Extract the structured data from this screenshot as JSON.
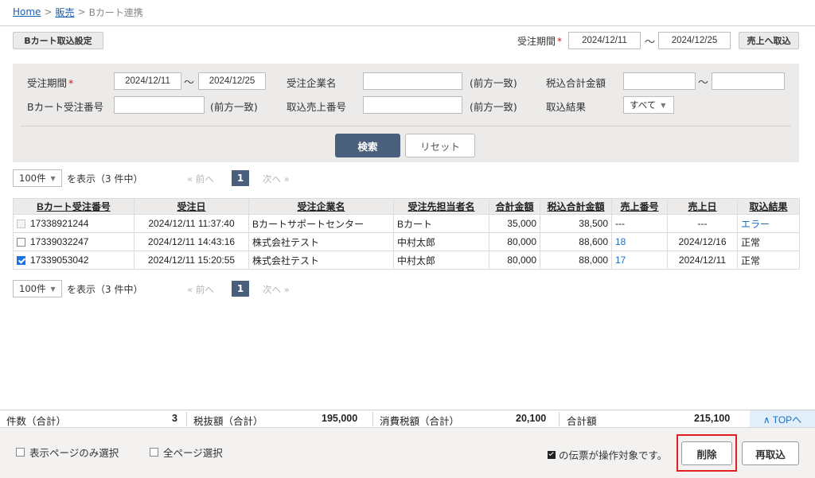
{
  "breadcrumb": {
    "home": "Home",
    "sep1": ">",
    "sales": "販売",
    "sep2": ">",
    "current": "Bカート連携"
  },
  "toolbar": {
    "settings_button": "Bカート取込設定",
    "period_label": "受注期間",
    "required_mark": "*",
    "date_from": "2024/12/11",
    "tilde": "～",
    "date_to": "2024/12/25",
    "import_button": "売上へ取込"
  },
  "search": {
    "period_label": "受注期間",
    "required_mark": "*",
    "date_from": "2024/12/11",
    "tilde": "～",
    "date_to": "2024/12/25",
    "company_label": "受注企業名",
    "company_value": "",
    "company_hint": "(前方一致)",
    "tax_total_label": "税込合計金額",
    "tax_total_from": "",
    "tax_total_tilde": "～",
    "tax_total_to": "",
    "order_no_label": "Bカート受注番号",
    "order_no_value": "",
    "order_no_hint": "(前方一致)",
    "sales_no_label": "取込売上番号",
    "sales_no_value": "",
    "sales_no_hint": "(前方一致)",
    "result_label": "取込結果",
    "result_value": "すべて",
    "search_button": "検索",
    "reset_button": "リセット"
  },
  "pager": {
    "per_page": "100件",
    "show_label": "を表示（3 件中）",
    "prev": "« 前へ",
    "current_page": "1",
    "next": "次へ »"
  },
  "table": {
    "headers": [
      "Bカート受注番号",
      "受注日",
      "受注企業名",
      "受注先担当者名",
      "合計金額",
      "税込合計金額",
      "売上番号",
      "売上日",
      "取込結果"
    ],
    "rows": [
      {
        "checkbox": "disabled",
        "order_no": "17338921244",
        "date": "2024/12/11 11:37:40",
        "company": "Bカートサポートセンター",
        "contact": "Bカート",
        "total": "35,000",
        "tax_total": "38,500",
        "sales_no": "---",
        "sales_date": "---",
        "result": "エラー"
      },
      {
        "checkbox": "unchecked",
        "order_no": "17339032247",
        "date": "2024/12/11 14:43:16",
        "company": "株式会社テスト",
        "contact": "中村太郎",
        "total": "80,000",
        "tax_total": "88,600",
        "sales_no": "18",
        "sales_date": "2024/12/16",
        "result": "正常"
      },
      {
        "checkbox": "checked",
        "order_no": "17339053042",
        "date": "2024/12/11 15:20:55",
        "company": "株式会社テスト",
        "contact": "中村太郎",
        "total": "80,000",
        "tax_total": "88,000",
        "sales_no": "17",
        "sales_date": "2024/12/11",
        "result": "正常"
      }
    ]
  },
  "totals": {
    "count_label": "件数（合計）",
    "count": "3",
    "pretax_label": "税抜額（合計）",
    "pretax": "195,000",
    "tax_label": "消費税額（合計）",
    "tax": "20,100",
    "grand_label": "合計額",
    "grand": "215,100",
    "top_link": "∧ TOPへ"
  },
  "footer": {
    "select_page_only": "表示ページのみ選択",
    "select_all_pages": "全ページ選択",
    "note": "の伝票が操作対象です。",
    "delete_button": "削除",
    "reimport_button": "再取込"
  },
  "colors": {
    "accent": "#4a5f7b",
    "link": "#1a6fc0",
    "highlight": "#e02020",
    "panel": "#ecebea"
  }
}
